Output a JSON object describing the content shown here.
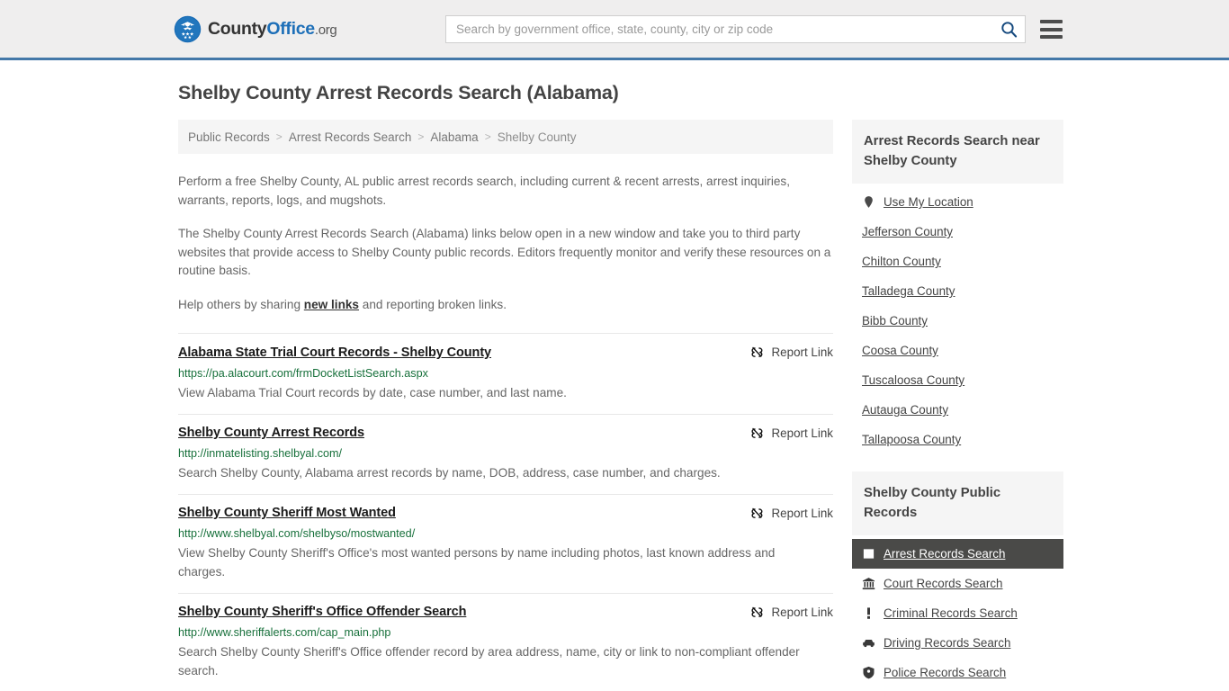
{
  "header": {
    "logo": {
      "icon": "eagle-seal-icon",
      "part1": "County",
      "part2": "Office",
      "tld": ".org"
    },
    "search": {
      "placeholder": "Search by government office, state, county, city or zip code",
      "value": "",
      "icon": "search-icon"
    },
    "menu_icon": "hamburger-menu-icon"
  },
  "page_title": "Shelby County Arrest Records Search (Alabama)",
  "breadcrumb": {
    "separator": ">",
    "items": [
      {
        "label": "Public Records"
      },
      {
        "label": "Arrest Records Search"
      },
      {
        "label": "Alabama"
      },
      {
        "label": "Shelby County"
      }
    ]
  },
  "intro": {
    "p1": "Perform a free Shelby County, AL public arrest records search, including current & recent arrests, arrest inquiries, warrants, reports, logs, and mugshots.",
    "p2": "The Shelby County Arrest Records Search (Alabama) links below open in a new window and take you to third party websites that provide access to Shelby County public records. Editors frequently monitor and verify these resources on a routine basis.",
    "p3_before": "Help others by sharing ",
    "p3_link": "new links",
    "p3_after": " and reporting broken links."
  },
  "report_link_label": "Report Link",
  "report_link_icon": "unlink-icon",
  "results": [
    {
      "title": "Alabama State Trial Court Records - Shelby County",
      "url": "https://pa.alacourt.com/frmDocketListSearch.aspx",
      "description": "View Alabama Trial Court records by date, case number, and last name."
    },
    {
      "title": "Shelby County Arrest Records",
      "url": "http://inmatelisting.shelbyal.com/",
      "description": "Search Shelby County, Alabama arrest records by name, DOB, address, case number, and charges."
    },
    {
      "title": "Shelby County Sheriff Most Wanted",
      "url": "http://www.shelbyal.com/shelbyso/mostwanted/",
      "description": "View Shelby County Sheriff's Office's most wanted persons by name including photos, last known address and charges."
    },
    {
      "title": "Shelby County Sheriff's Office Offender Search",
      "url": "http://www.sheriffalerts.com/cap_main.php",
      "description": "Search Shelby County Sheriff's Office offender record by area address, name, city or link to non-compliant offender search."
    }
  ],
  "sidebar": {
    "nearby": {
      "heading": "Arrest Records Search near Shelby County",
      "items": [
        {
          "label": "Use My Location",
          "icon": "map-pin-icon"
        },
        {
          "label": "Jefferson County",
          "icon": ""
        },
        {
          "label": "Chilton County",
          "icon": ""
        },
        {
          "label": "Talladega County",
          "icon": ""
        },
        {
          "label": "Bibb County",
          "icon": ""
        },
        {
          "label": "Coosa County",
          "icon": ""
        },
        {
          "label": "Tuscaloosa County",
          "icon": ""
        },
        {
          "label": "Autauga County",
          "icon": ""
        },
        {
          "label": "Tallapoosa County",
          "icon": ""
        }
      ]
    },
    "public_records": {
      "heading": "Shelby County Public Records",
      "items": [
        {
          "label": "Arrest Records Search",
          "icon": "square-icon",
          "active": true
        },
        {
          "label": "Court Records Search",
          "icon": "bank-icon",
          "active": false
        },
        {
          "label": "Criminal Records Search",
          "icon": "exclamation-icon",
          "active": false
        },
        {
          "label": "Driving Records Search",
          "icon": "car-icon",
          "active": false
        },
        {
          "label": "Police Records Search",
          "icon": "shield-icon",
          "active": false
        }
      ]
    }
  },
  "colors": {
    "header_bg": "#efeeee",
    "header_border": "#4478a8",
    "brand_blue": "#1d6fb8",
    "url_green": "#17703b",
    "active_bg": "#4a4a48",
    "panel_bg": "#f5f5f5"
  }
}
